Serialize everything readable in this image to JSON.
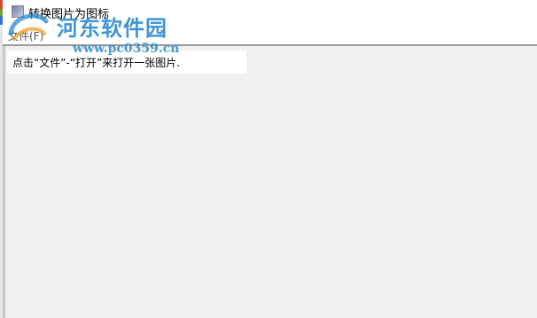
{
  "window": {
    "title": "转换图片为图标"
  },
  "menu": {
    "file_label": "文件(F)"
  },
  "content": {
    "hint": "点击“文件”-“打开”来打开一张图片."
  },
  "watermark": {
    "name": "河东软件园",
    "url": "www.pc0359.cn"
  },
  "colors": {
    "client_bg": "#f0f0f0",
    "watermark": "#2a8bd1"
  }
}
